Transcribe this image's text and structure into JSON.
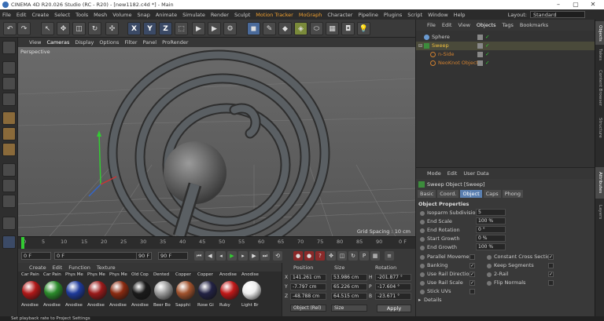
{
  "title": "CINEMA 4D R20.026 Studio (RC - R20) - [new1182.c4d *] - Main",
  "menu": [
    "File",
    "Edit",
    "Create",
    "Select",
    "Tools",
    "Mesh",
    "Volume",
    "Snap",
    "Animate",
    "Simulate",
    "Render",
    "Sculpt",
    "Motion Tracker",
    "MoGraph",
    "Character",
    "Pipeline",
    "Plugins",
    "Script",
    "Window",
    "Help"
  ],
  "layout": {
    "label": "Layout:",
    "value": "Standard"
  },
  "toolbar": {
    "x": "X",
    "y": "Y",
    "z": "Z"
  },
  "viewmenu": [
    "View",
    "Cameras",
    "Display",
    "Options",
    "Filter",
    "Panel",
    "ProRender"
  ],
  "viewport": {
    "label": "Perspective",
    "grid_spacing": "Grid Spacing : 10 cm"
  },
  "timeline": {
    "ticks": [
      "0",
      "5",
      "10",
      "15",
      "20",
      "25",
      "30",
      "35",
      "40",
      "45",
      "50",
      "55",
      "60",
      "65",
      "70",
      "75",
      "80",
      "85",
      "90"
    ],
    "end_frame": "0 F"
  },
  "transport": {
    "start": "0 F",
    "current": "0 F",
    "end": "90 F",
    "max": "90 F"
  },
  "material_menu": [
    "Create",
    "Edit",
    "Function",
    "Texture"
  ],
  "materials": [
    {
      "name": "Car Pain",
      "color": "#b01818"
    },
    {
      "name": "Car Pain",
      "color": "#2a8a2a"
    },
    {
      "name": "Phys Me",
      "color": "#1e3a9a"
    },
    {
      "name": "Phys Me",
      "color": "#9a1a1a"
    },
    {
      "name": "Phys Me",
      "color": "#8a2a10"
    },
    {
      "name": "Old Cop",
      "color": "#1a1a1a"
    },
    {
      "name": "Dented",
      "color": "#9a9a9a"
    },
    {
      "name": "Copper",
      "color": "#a0522d"
    },
    {
      "name": "Copper",
      "color": "#222244"
    },
    {
      "name": "Anodise",
      "color": "#c01818"
    },
    {
      "name": "Anodise",
      "color": "#eeeeee"
    }
  ],
  "materials_row2": [
    "Anodise",
    "Anodise",
    "Anodise",
    "Anodise",
    "Anodise",
    "Anodise",
    "Beer Bo",
    "Sapphi",
    "Rose Gi",
    "Ruby",
    "Light Br"
  ],
  "coords": {
    "headers": {
      "position": "Position",
      "size": "Size",
      "rotation": "Rotation"
    },
    "rows": [
      {
        "axis": "X",
        "pos": "141.261 cm",
        "size": "53.986 cm",
        "rot_axis": "H",
        "rot": "-201.877 °"
      },
      {
        "axis": "Y",
        "pos": "-7.797 cm",
        "size": "65.226 cm",
        "rot_axis": "P",
        "rot": "-17.604 °"
      },
      {
        "axis": "Z",
        "pos": "-48.788 cm",
        "size": "64.515 cm",
        "rot_axis": "B",
        "rot": "-23.671 °"
      }
    ],
    "mode": "Object (Rel)",
    "size_mode": "Size",
    "apply": "Apply"
  },
  "status": "Set playback rate to Project Settings",
  "object_menu": [
    "File",
    "Edit",
    "View",
    "Objects",
    "Tags",
    "Bookmarks"
  ],
  "objects": [
    {
      "name": "Sphere",
      "color": "#ccc"
    },
    {
      "name": "Sweep",
      "color": "#f0c040"
    },
    {
      "name": "n-Side",
      "color": "#d08030"
    },
    {
      "name": "NeoKnot Object",
      "color": "#d08030"
    }
  ],
  "attr_menu": [
    "Mode",
    "Edit",
    "User Data"
  ],
  "attr_title": "Sweep Object [Sweep]",
  "attr_tabs": [
    "Basic",
    "Coord.",
    "Object",
    "Caps",
    "Phong"
  ],
  "attr_section": "Object Properties",
  "attr_fields": [
    {
      "label": "Isoparm Subdivision",
      "value": "5"
    },
    {
      "label": "End Scale",
      "value": "100 %"
    },
    {
      "label": "End Rotation",
      "value": "0 °"
    },
    {
      "label": "Start Growth",
      "value": "0 %"
    },
    {
      "label": "End Growth",
      "value": "100 %"
    }
  ],
  "attr_checks_left": [
    {
      "label": "Parallel Movement",
      "checked": ""
    },
    {
      "label": "Banking",
      "checked": "✓"
    },
    {
      "label": "Use Rail Direction",
      "checked": "✓"
    },
    {
      "label": "Use Rail Scale",
      "checked": "✓"
    },
    {
      "label": "Stick UVs",
      "checked": ""
    }
  ],
  "attr_checks_right": [
    {
      "label": "Constant Cross Section",
      "checked": "✓"
    },
    {
      "label": "Keep Segments",
      "checked": ""
    },
    {
      "label": "2-Rail",
      "checked": "✓"
    },
    {
      "label": "Flip Normals",
      "checked": ""
    }
  ],
  "details": "Details",
  "vtabs": [
    "Objects",
    "Takes",
    "Content Browser",
    "Structure",
    "Attributes",
    "Layers"
  ]
}
